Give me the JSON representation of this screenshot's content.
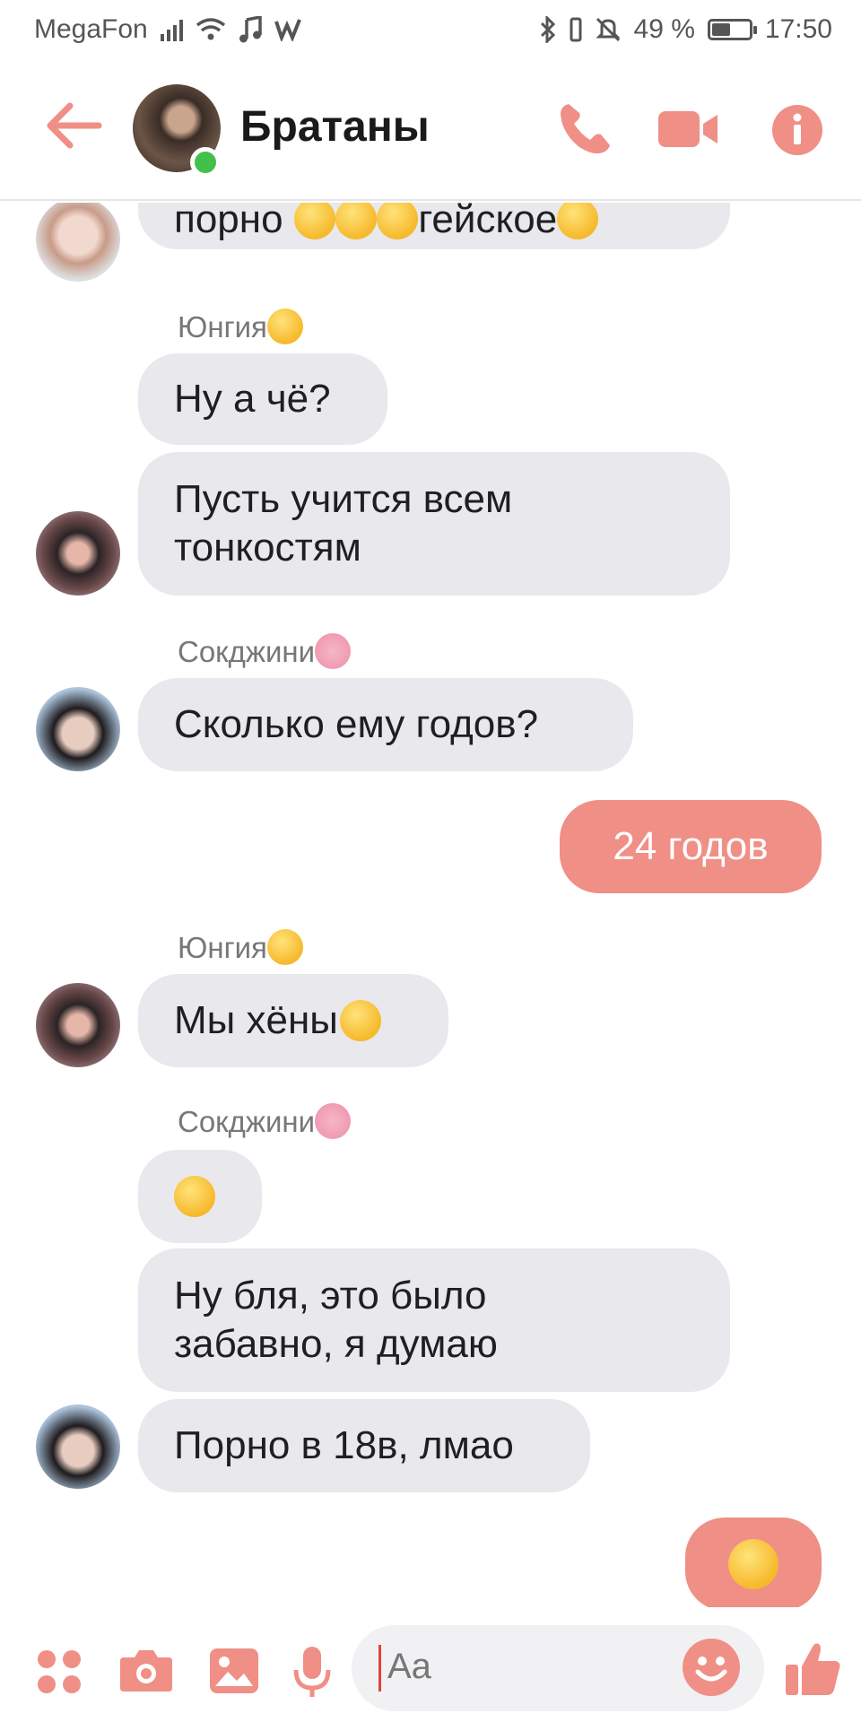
{
  "status_bar": {
    "carrier": "MegaFon",
    "battery_text": "49 %",
    "battery_fraction": 0.49,
    "time": "17:50"
  },
  "header": {
    "title": "Братаны",
    "icons": [
      "back-arrow-icon",
      "phone-icon",
      "video-camera-icon",
      "info-icon"
    ],
    "accent": "#ef8f86"
  },
  "messages": {
    "m1": "порно",
    "m1_tail": "гейское",
    "sender_yungiya": "Юнгия",
    "m2": "Ну а чё?",
    "m3_line1": "Пусть учится всем",
    "m3_line2": "тонкостям",
    "sender_sokdzhini": "Сокджини",
    "m4": "Сколько ему годов?",
    "m5": "24 годов",
    "sender_yungiya_2": "Юнгия",
    "m6": "Мы хёны",
    "sender_sokdzhini_2": "Сокджини",
    "m8_line1": "Ну бля, это было",
    "m8_line2": "забавно, я думаю",
    "m9": "Порно в 18в, лмао"
  },
  "input": {
    "placeholder": "Aa"
  },
  "colors": {
    "my_bubble": "#ef8f86",
    "their_bubble": "#e9e8ec",
    "online": "#43c04a"
  }
}
